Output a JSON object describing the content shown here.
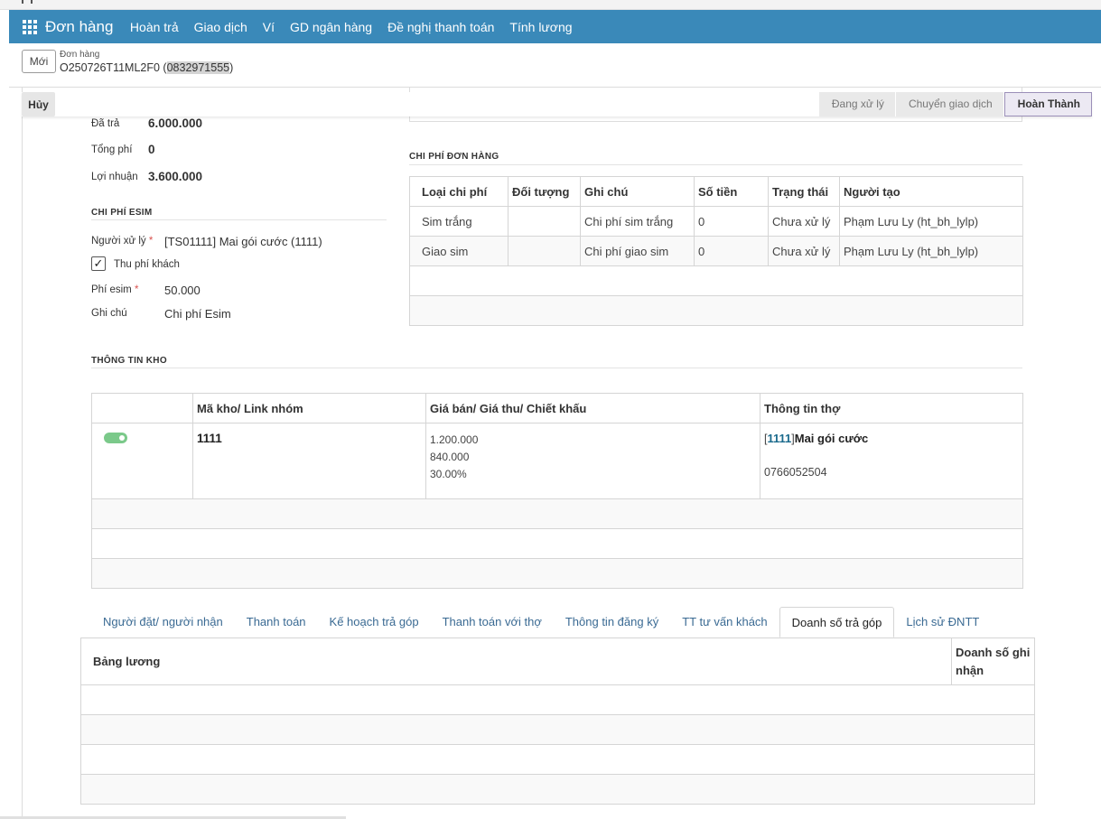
{
  "nav": {
    "brand": "Đơn hàng",
    "items": [
      "Hoàn trả",
      "Giao dịch",
      "Ví",
      "GD ngân hàng",
      "Đề nghị thanh toán",
      "Tính lương"
    ]
  },
  "control_panel": {
    "new_label": "Mới",
    "breadcrumb_parent": "Đơn hàng",
    "record_code": "O250726T11ML2F0 (",
    "record_phone": "0832971555",
    "record_close": ")"
  },
  "statusbar": {
    "cancel_label": "Hủy",
    "stages": [
      "Đang xử lý",
      "Chuyển giao dịch",
      "Hoàn Thành"
    ],
    "current_stage": "Hoàn Thành"
  },
  "summary": {
    "da_tra_label": "Đã trả",
    "da_tra_value": "6.000.000",
    "tong_phi_label": "Tổng phí",
    "tong_phi_value": "0",
    "loi_nhuan_label": "Lợi nhuận",
    "loi_nhuan_value": "3.600.000"
  },
  "esim": {
    "title": "CHI PHÍ ESIM",
    "nguoi_xu_ly_label": "Người xử lý",
    "nguoi_xu_ly_value": "[TS01111] Mai gói cước (1111)",
    "thu_phi_label": "Thu phí khách",
    "thu_phi_checked": true,
    "phi_esim_label": "Phí esim",
    "phi_esim_value": "50.000",
    "ghi_chu_label": "Ghi chú",
    "ghi_chu_value": "Chi phí Esim",
    "required_mark": "*"
  },
  "order_cost": {
    "title": "CHI PHÍ ĐƠN HÀNG",
    "headers": [
      "Loại chi phí",
      "Đối tượng",
      "Ghi chú",
      "Số tiền",
      "Trạng thái",
      "Người tạo"
    ],
    "rows": [
      [
        "Sim trắng",
        "",
        "Chi phí sim trắng",
        "0",
        "Chưa xử lý",
        "Phạm Lưu Ly (ht_bh_lylp)"
      ],
      [
        "Giao sim",
        "",
        "Chi phí giao sim",
        "0",
        "Chưa xử lý",
        "Phạm Lưu Ly (ht_bh_lylp)"
      ]
    ]
  },
  "kho": {
    "title": "THÔNG TIN KHO",
    "headers": [
      "",
      "Mã kho/ Link nhóm",
      "Giá bán/ Giá thu/ Chiết khấu",
      "Thông tin thợ"
    ],
    "row": {
      "toggle_on": true,
      "ma_kho": "1111",
      "gia_ban": "1.200.000",
      "gia_thu": "840.000",
      "chiet_khau": "30.00%",
      "tho_open": "[",
      "tho_code": "1111",
      "tho_close": "]",
      "tho_name": "Mai gói cước",
      "tho_phone": "0766052504"
    }
  },
  "tabs": {
    "items": [
      "Người đặt/ người nhận",
      "Thanh toán",
      "Kế hoạch trả góp",
      "Thanh toán với thợ",
      "Thông tin đăng ký",
      "TT tư vấn khách",
      "Doanh số trả góp",
      "Lịch sử ĐNTT"
    ],
    "active": "Doanh số trả góp"
  },
  "luong": {
    "headers": [
      "Bảng lương",
      "Doanh số ghi nhận"
    ]
  },
  "colors": {
    "navbar": "#3a89b9",
    "toggle": "#7bc98a",
    "link": "#3a6a93",
    "required": "#d9534f"
  }
}
